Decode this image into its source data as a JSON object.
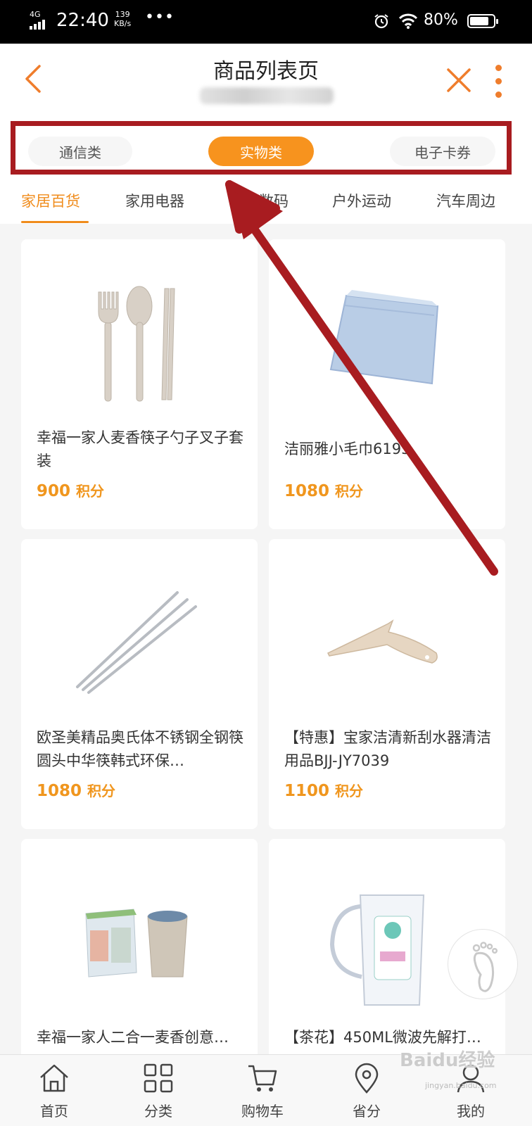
{
  "status_bar": {
    "network": "4G",
    "time": "22:40",
    "speed_value": "139",
    "speed_unit": "KB/s",
    "more": "•••",
    "battery": "80%",
    "battery_level": 0.8
  },
  "header": {
    "title": "商品列表页",
    "back_icon": "chevron-left-icon",
    "close_icon": "close-icon",
    "more_icon": "more-vertical-icon"
  },
  "segments": [
    {
      "label": "通信类",
      "active": false
    },
    {
      "label": "实物类",
      "active": true
    },
    {
      "label": "电子卡券",
      "active": false
    }
  ],
  "categories": [
    {
      "label": "家居百货",
      "active": true
    },
    {
      "label": "家用电器",
      "active": false
    },
    {
      "label": "手机数码",
      "active": false
    },
    {
      "label": "户外运动",
      "active": false
    },
    {
      "label": "汽车周边",
      "active": false
    }
  ],
  "products": [
    {
      "name": "幸福一家人麦香筷子勺子叉子套装",
      "price": "900",
      "unit": "积分",
      "image": "cutlery-set"
    },
    {
      "name": "洁丽雅小毛巾6193",
      "price": "1080",
      "unit": "积分",
      "image": "towel"
    },
    {
      "name": "欧圣美精品奥氏体不锈钢全钢筷圆头中华筷韩式环保…",
      "price": "1080",
      "unit": "积分",
      "image": "chopsticks"
    },
    {
      "name": "【特惠】宝家洁清新刮水器清洁用品BJJ-JY7039",
      "price": "1100",
      "unit": "积分",
      "image": "squeegee"
    },
    {
      "name": "幸福一家人二合一麦香创意…",
      "price": "",
      "unit": "",
      "image": "cup-set"
    },
    {
      "name": "【茶花】450ML微波先解打…",
      "price": "",
      "unit": "",
      "image": "pitcher"
    }
  ],
  "floating_button_icon": "footprint-icon",
  "tabbar": [
    {
      "label": "首页",
      "icon": "home-icon"
    },
    {
      "label": "分类",
      "icon": "category-icon"
    },
    {
      "label": "购物车",
      "icon": "cart-icon"
    },
    {
      "label": "省分",
      "icon": "location-icon"
    },
    {
      "label": "我的",
      "icon": "user-icon"
    }
  ],
  "watermark": {
    "logo": "Baidu经验",
    "url": "jingyan.baidu.com"
  },
  "colors": {
    "accent": "#f7931e",
    "price": "#f0961e",
    "annotation": "#a81c20",
    "icon": "#ef7d2c"
  }
}
